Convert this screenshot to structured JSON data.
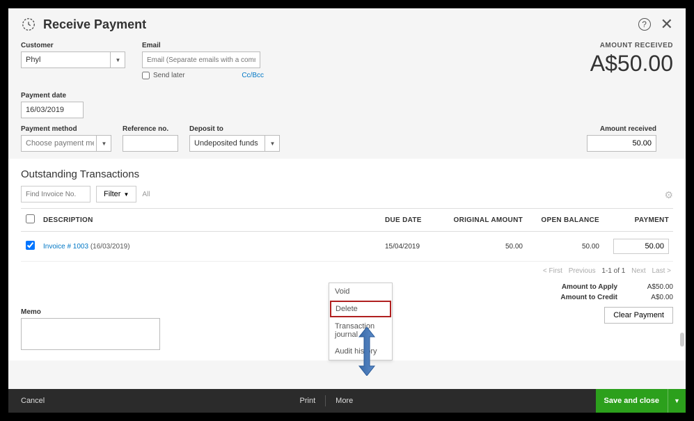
{
  "header": {
    "title": "Receive Payment"
  },
  "customer": {
    "label": "Customer",
    "value": "Phyl"
  },
  "email": {
    "label": "Email",
    "placeholder": "Email (Separate emails with a comma)",
    "send_later": "Send later",
    "ccbcc": "Cc/Bcc"
  },
  "amount_received_big": {
    "label": "AMOUNT RECEIVED",
    "value": "A$50.00"
  },
  "payment_date": {
    "label": "Payment date",
    "value": "16/03/2019"
  },
  "payment_method": {
    "label": "Payment method",
    "placeholder": "Choose payment method"
  },
  "reference": {
    "label": "Reference no."
  },
  "deposit": {
    "label": "Deposit to",
    "value": "Undeposited funds"
  },
  "amount_received": {
    "label": "Amount received",
    "value": "50.00"
  },
  "outstanding": {
    "title": "Outstanding Transactions",
    "find_placeholder": "Find Invoice No.",
    "filter_label": "Filter",
    "all": "All",
    "columns": {
      "desc": "DESCRIPTION",
      "due": "DUE DATE",
      "orig": "ORIGINAL AMOUNT",
      "open": "OPEN BALANCE",
      "pay": "PAYMENT"
    },
    "rows": [
      {
        "checked": true,
        "link": "Invoice # 1003",
        "date_paren": "(16/03/2019)",
        "due": "15/04/2019",
        "orig": "50.00",
        "open": "50.00",
        "pay": "50.00"
      }
    ],
    "pager": {
      "first": "< First",
      "prev": "Previous",
      "range": "1-1 of 1",
      "next": "Next",
      "last": "Last >"
    }
  },
  "totals": {
    "apply_label": "Amount to Apply",
    "apply_value": "A$50.00",
    "credit_label": "Amount to Credit",
    "credit_value": "A$0.00",
    "clear": "Clear Payment"
  },
  "memo": {
    "label": "Memo"
  },
  "more_menu": {
    "void": "Void",
    "delete": "Delete",
    "journal": "Transaction journal",
    "audit": "Audit history"
  },
  "footer": {
    "cancel": "Cancel",
    "print": "Print",
    "more": "More",
    "save": "Save and close"
  }
}
